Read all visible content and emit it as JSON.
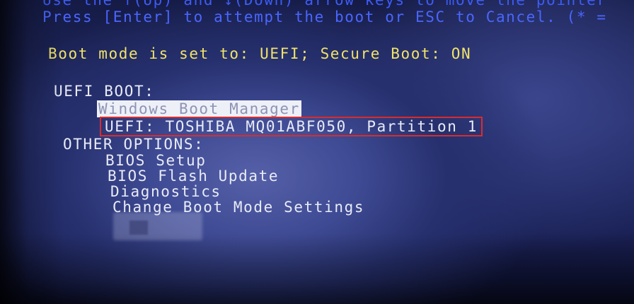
{
  "header": {
    "instruction_line_1": "Use the ↑(Up) and ↓(Down) arrow keys to move the pointer",
    "instruction_line_2": "Press [Enter] to attempt the boot or ESC to Cancel. (* = "
  },
  "status": {
    "boot_mode_text": "Boot mode is set to: UEFI; Secure Boot: ON"
  },
  "uefi_boot": {
    "heading": "UEFI BOOT:",
    "items": [
      {
        "label": "Windows Boot Manager",
        "selected": true
      },
      {
        "label": "UEFI: TOSHIBA MQ01ABF050, Partition 1",
        "highlighted": true
      }
    ]
  },
  "other_options": {
    "heading": "OTHER OPTIONS:",
    "items": [
      {
        "label": "BIOS Setup"
      },
      {
        "label": "BIOS Flash Update"
      },
      {
        "label": "Diagnostics"
      },
      {
        "label": "Change Boot Mode Settings"
      }
    ]
  },
  "colors": {
    "instruction_text": "#4a66ff",
    "status_text": "#f0e36a",
    "menu_text": "#e9ebf6",
    "selection_bg": "#eef0f8",
    "highlight_border": "#d92c2c"
  }
}
